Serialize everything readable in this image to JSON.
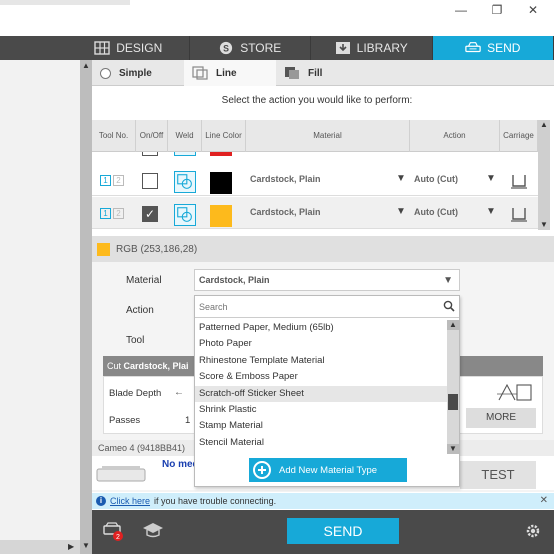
{
  "window": {
    "minimize": "—",
    "restore": "❐",
    "close": "✕"
  },
  "nav": {
    "tabs": [
      {
        "label": "DESIGN",
        "icon": "design-grid-icon"
      },
      {
        "label": "STORE",
        "icon": "store-s-icon"
      },
      {
        "label": "LIBRARY",
        "icon": "library-download-icon"
      },
      {
        "label": "SEND",
        "icon": "send-machine-icon",
        "active": true
      }
    ]
  },
  "mode_tabs": {
    "simple": "Simple",
    "line": "Line",
    "fill": "Fill",
    "active": "Line"
  },
  "prompt": "Select the action you would like to perform:",
  "table": {
    "headers": {
      "tool_no": "Tool No.",
      "on_off": "On/Off",
      "weld": "Weld",
      "line_color": "Line Color",
      "material": "Material",
      "action": "Action",
      "carriage": "Carriage"
    },
    "rows": [
      {
        "tool1": "1",
        "tool2": "2",
        "on": false,
        "line_color": "#000000",
        "material": "Cardstock, Plain",
        "action": "Auto (Cut)"
      },
      {
        "tool1": "1",
        "tool2": "2",
        "on": true,
        "line_color": "#fdba1c",
        "material": "Cardstock, Plain",
        "action": "Auto (Cut)"
      }
    ],
    "partial_row_color": "#e02020"
  },
  "rgb": {
    "label": "RGB (253,186,28)",
    "color": "#fdba1c"
  },
  "settings": {
    "material_label": "Material",
    "material_value": "Cardstock, Plain",
    "action_label": "Action",
    "tool_label": "Tool",
    "cut_prefix": "Cut",
    "cut_material": "Cardstock, Plai",
    "blade_depth_label": "Blade Depth",
    "passes_label": "Passes",
    "passes_value": "1",
    "more_label": "MORE",
    "machine": "Cameo 4 (9418BB41)",
    "no_media": "No med",
    "test_label": "TEST"
  },
  "dropdown": {
    "search_placeholder": "Search",
    "items": [
      "Patterned Paper, Medium (65lb)",
      "Photo Paper",
      "Rhinestone Template Material",
      "Score & Emboss Paper",
      "Scratch-off Sticker Sheet",
      "Shrink Plastic",
      "Stamp Material",
      "Stencil Material"
    ],
    "highlighted_index": 4,
    "add_label": "Add New Material Type"
  },
  "info": {
    "link": "Click here",
    "text": "if you have trouble connecting.",
    "close": "✕"
  },
  "bottom": {
    "send_label": "SEND"
  },
  "colors": {
    "accent": "#17a9d8",
    "dark": "#4a4a4a"
  }
}
